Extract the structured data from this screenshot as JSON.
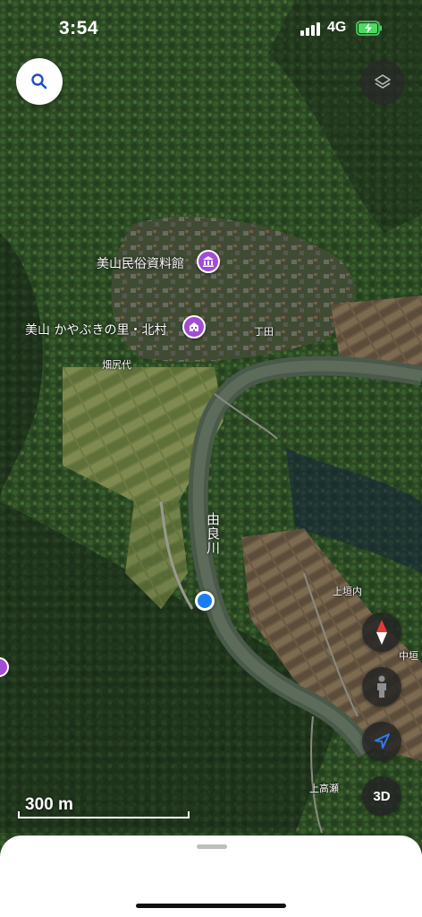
{
  "status_bar": {
    "time": "3:54",
    "network": "4G"
  },
  "map": {
    "labels": {
      "museum": "美山民俗資料館",
      "village": "美山 かやぶきの里・北村",
      "choda": "丁田",
      "hatajiroshiro": "畑尻代",
      "river": "由良川",
      "kamigakiuchi": "上垣内",
      "nakagaki": "中垣",
      "kamitakase": "上高瀬"
    },
    "icons": {
      "search": "search-icon",
      "layers": "layers-icon",
      "museum_poi": "museum-icon",
      "village_poi": "building-icon",
      "compass": "compass-icon",
      "look_around": "person-icon",
      "locate": "location-arrow-icon"
    },
    "colors": {
      "poi": "#a34cd6",
      "user_location": "#1b7cf2",
      "compass_north": "#e53935"
    }
  },
  "controls": {
    "view_3d_label": "3D"
  },
  "scale": {
    "label": "300 m"
  }
}
